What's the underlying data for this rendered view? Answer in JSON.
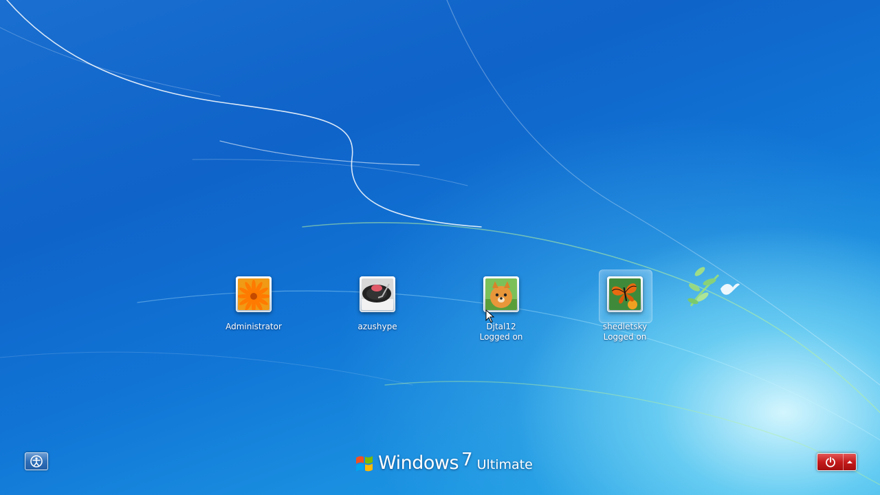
{
  "users": [
    {
      "name": "Administrator",
      "status": "",
      "avatar": "orange-flower"
    },
    {
      "name": "azushype",
      "status": "",
      "avatar": "turntable"
    },
    {
      "name": "Djtal12",
      "status": "Logged on",
      "avatar": "pomeranian-dog"
    },
    {
      "name": "shedletsky",
      "status": "Logged on",
      "avatar": "butterfly",
      "selected": true
    }
  ],
  "branding": {
    "windows": "Windows",
    "version": "7",
    "edition": "Ultimate"
  },
  "buttons": {
    "ease_of_access": "ease-of-access-icon",
    "shutdown": "power-icon",
    "shutdown_options": "triangle-up-icon"
  },
  "colors": {
    "background": "#1170d4",
    "shutdown": "#c41b1b"
  }
}
